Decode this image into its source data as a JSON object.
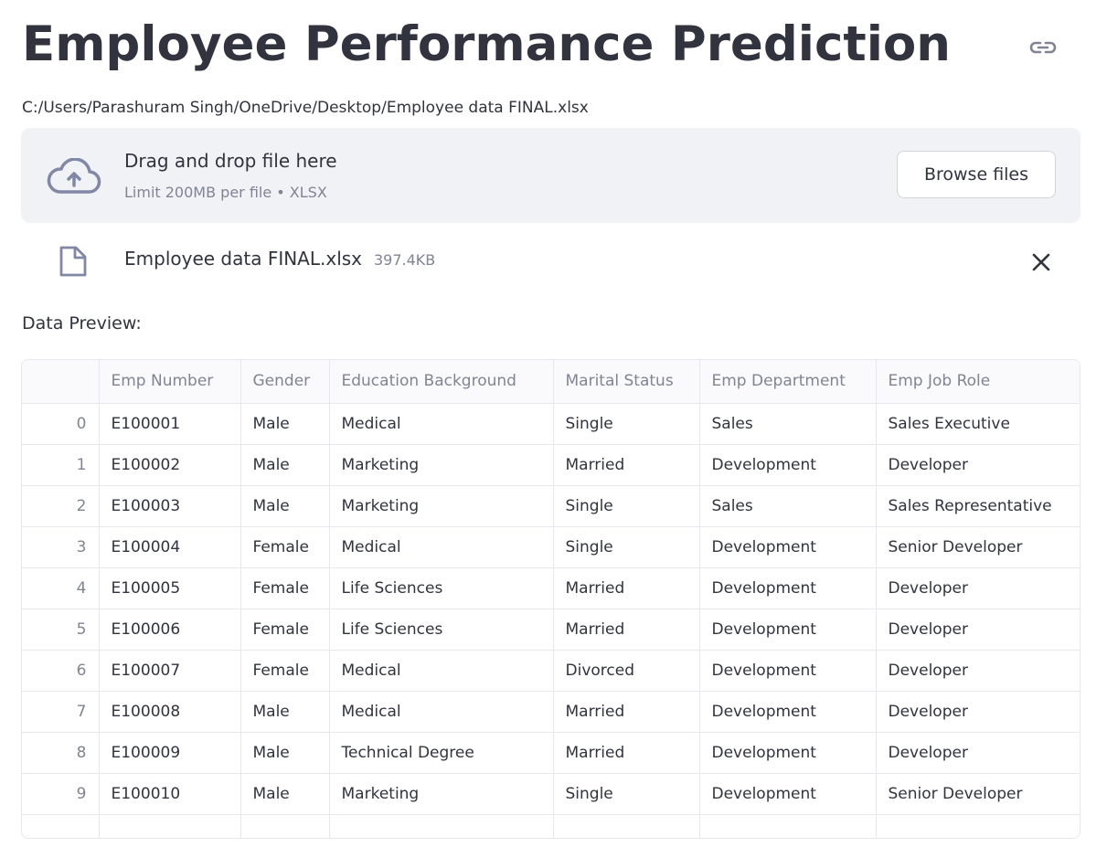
{
  "page": {
    "title": "Employee Performance Prediction",
    "file_path": "C:/Users/Parashuram Singh/OneDrive/Desktop/Employee data FINAL.xlsx"
  },
  "uploader": {
    "drop_title": "Drag and drop file here",
    "drop_subtitle": "Limit 200MB per file • XLSX",
    "browse_label": "Browse files",
    "icon": "cloud-upload-icon"
  },
  "uploaded_file": {
    "name": "Employee data FINAL.xlsx",
    "size": "397.4KB",
    "icon": "file-icon",
    "remove_icon": "close-icon"
  },
  "preview": {
    "label": "Data Preview:",
    "columns": [
      "",
      "Emp Number",
      "Gender",
      "Education Background",
      "Marital Status",
      "Emp Department",
      "Emp Job Role"
    ],
    "rows": [
      [
        "0",
        "E100001",
        "Male",
        "Medical",
        "Single",
        "Sales",
        "Sales Executive"
      ],
      [
        "1",
        "E100002",
        "Male",
        "Marketing",
        "Married",
        "Development",
        "Developer"
      ],
      [
        "2",
        "E100003",
        "Male",
        "Marketing",
        "Single",
        "Sales",
        "Sales Representative"
      ],
      [
        "3",
        "E100004",
        "Female",
        "Medical",
        "Single",
        "Development",
        "Senior Developer"
      ],
      [
        "4",
        "E100005",
        "Female",
        "Life Sciences",
        "Married",
        "Development",
        "Developer"
      ],
      [
        "5",
        "E100006",
        "Female",
        "Life Sciences",
        "Married",
        "Development",
        "Developer"
      ],
      [
        "6",
        "E100007",
        "Female",
        "Medical",
        "Divorced",
        "Development",
        "Developer"
      ],
      [
        "7",
        "E100008",
        "Male",
        "Medical",
        "Married",
        "Development",
        "Developer"
      ],
      [
        "8",
        "E100009",
        "Male",
        "Technical Degree",
        "Married",
        "Development",
        "Developer"
      ],
      [
        "9",
        "E100010",
        "Male",
        "Marketing",
        "Single",
        "Development",
        "Senior Developer"
      ]
    ]
  },
  "colors": {
    "text": "#31333f",
    "muted": "#808495",
    "uploader_bg": "#f0f2f6",
    "border": "#e6e8ee"
  }
}
